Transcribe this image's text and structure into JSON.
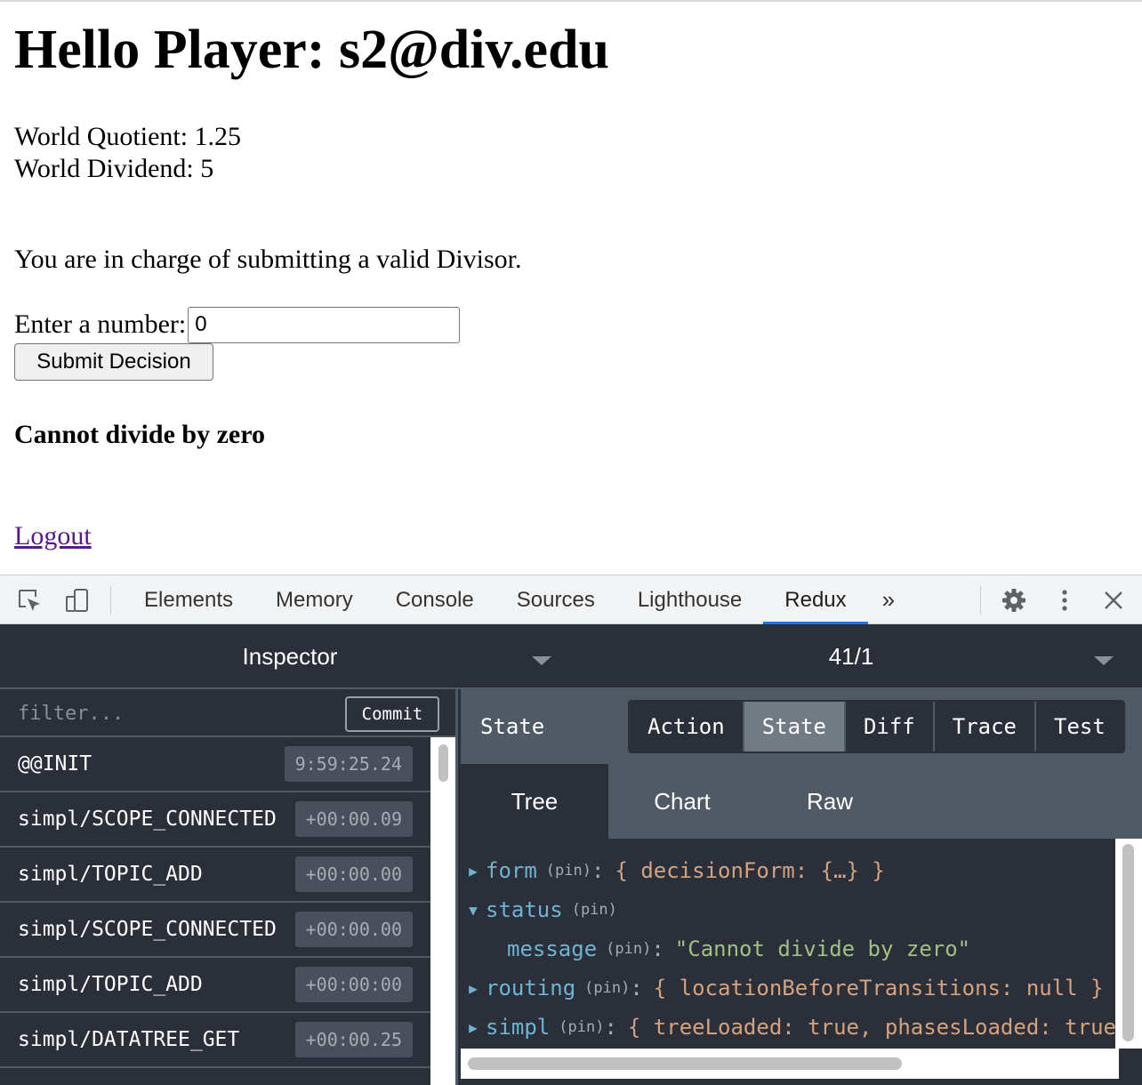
{
  "page": {
    "heading": "Hello Player: s2@div.edu",
    "world_quotient": "World Quotient: 1.25",
    "world_dividend": "World Dividend: 5",
    "instructions": "You are in charge of submitting a valid Divisor.",
    "input_label": "Enter a number:",
    "input_value": "0",
    "submit_label": "Submit Decision",
    "error_message": "Cannot divide by zero",
    "logout_label": "Logout"
  },
  "devtools": {
    "tabs": [
      {
        "label": "Elements"
      },
      {
        "label": "Memory"
      },
      {
        "label": "Console"
      },
      {
        "label": "Sources"
      },
      {
        "label": "Lighthouse"
      },
      {
        "label": "Redux",
        "active": true
      }
    ],
    "overflow_glyph": "»",
    "icons": [
      "inspect-element-icon",
      "device-toolbar-icon",
      "more-tabs-icon",
      "gear-icon",
      "kebab-menu-icon",
      "close-icon"
    ],
    "active_tab_color": "#1a73e8"
  },
  "redux": {
    "monitor_select": "Inspector",
    "instance_select": "41/1",
    "filter_placeholder": "filter...",
    "commit_label": "Commit",
    "actions": [
      {
        "name": "@@INIT",
        "time": "9:59:25.24"
      },
      {
        "name": "simpl/SCOPE_CONNECTED",
        "time": "+00:00.09"
      },
      {
        "name": "simpl/TOPIC_ADD",
        "time": "+00:00.00"
      },
      {
        "name": "simpl/SCOPE_CONNECTED",
        "time": "+00:00.00"
      },
      {
        "name": "simpl/TOPIC_ADD",
        "time": "+00:00:00"
      },
      {
        "name": "simpl/DATATREE_GET",
        "time": "+00:00.25"
      }
    ],
    "panel_title": "State",
    "segments": [
      {
        "label": "Action"
      },
      {
        "label": "State",
        "active": true
      },
      {
        "label": "Diff"
      },
      {
        "label": "Trace"
      },
      {
        "label": "Test"
      }
    ],
    "view_tabs": [
      {
        "label": "Tree",
        "active": true
      },
      {
        "label": "Chart"
      },
      {
        "label": "Raw"
      }
    ],
    "tree": {
      "pin_label": "(pin)",
      "colon": ":",
      "form": {
        "key": "form",
        "value": "{ decisionForm: {…} }"
      },
      "status": {
        "key": "status"
      },
      "message": {
        "key": "message",
        "value": "\"Cannot divide by zero\""
      },
      "routing": {
        "key": "routing",
        "value": "{ locationBeforeTransitions: null }"
      },
      "simpl": {
        "key": "simpl",
        "value": "{ treeLoaded: true, phasesLoaded: true"
      }
    },
    "colors": {
      "background": "#2a2f3a",
      "border": "#4f5a65",
      "key": "#6fb3d2",
      "string": "#a1c181",
      "value": "#d5a27e"
    }
  }
}
